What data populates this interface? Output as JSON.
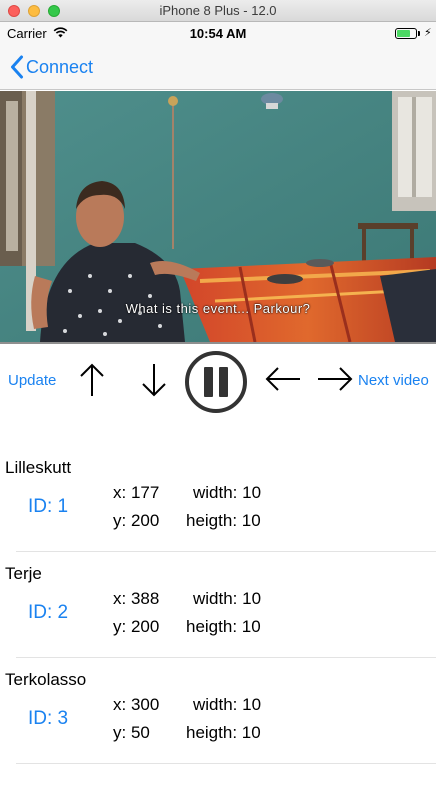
{
  "window": {
    "title": "iPhone 8 Plus - 12.0"
  },
  "status_bar": {
    "carrier": "Carrier",
    "time": "10:54 AM",
    "battery_level": 0.7
  },
  "nav": {
    "back_label": "Connect"
  },
  "video": {
    "subtitle": "What is this event... Parkour?"
  },
  "controls": {
    "update_label": "Update",
    "next_video_label": "Next video",
    "accent_color": "#1a82f0"
  },
  "objects": [
    {
      "name": "Lilleskutt",
      "id": "ID: 1",
      "x": "x: 177",
      "y": "y: 200",
      "width": "width: 10",
      "height": "heigth: 10"
    },
    {
      "name": "Terje",
      "id": "ID: 2",
      "x": "x: 388",
      "y": "y: 200",
      "width": "width: 10",
      "height": "heigth: 10"
    },
    {
      "name": "Terkolasso",
      "id": "ID: 3",
      "x": "x: 300",
      "y": "y: 50",
      "width": "width: 10",
      "height": "heigth: 10"
    }
  ]
}
